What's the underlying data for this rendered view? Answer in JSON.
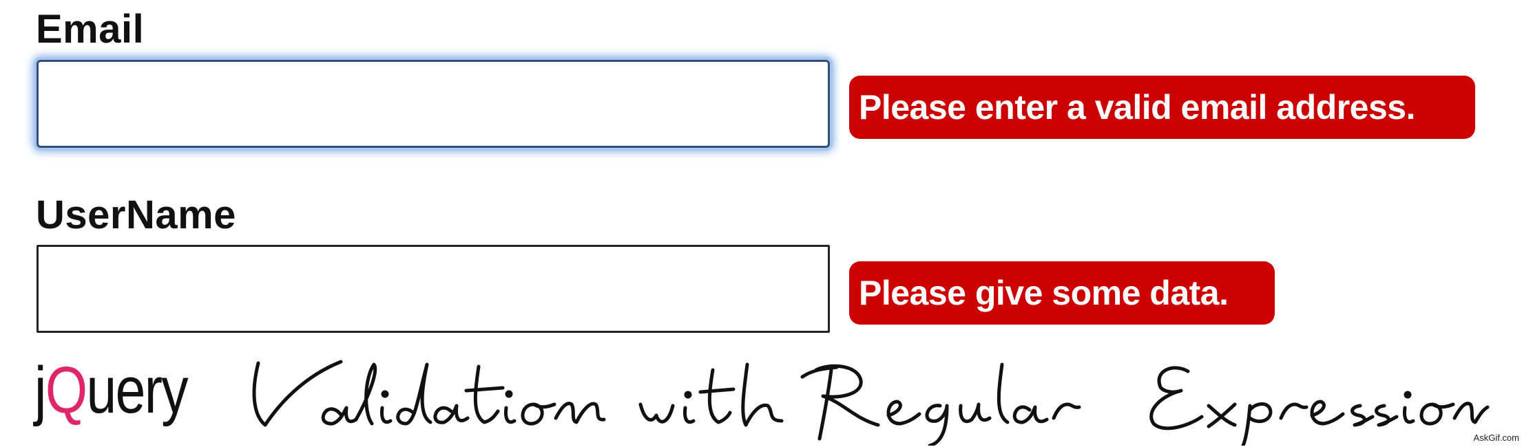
{
  "form": {
    "email": {
      "label": "Email",
      "value": "",
      "error": "Please enter a valid email address."
    },
    "username": {
      "label": "UserName",
      "value": "",
      "error": "Please give some data."
    }
  },
  "caption": {
    "prefix_j": "j",
    "prefix_q": "Q",
    "prefix_rest": "uery",
    "script_text": "Validation with Regular Expression",
    "q_color": "#e0256a"
  },
  "watermark": "AskGif.com",
  "colors": {
    "error_background": "#cc0000",
    "focus_border": "#2f4f7a",
    "focus_glow": "#8fb5e8"
  }
}
